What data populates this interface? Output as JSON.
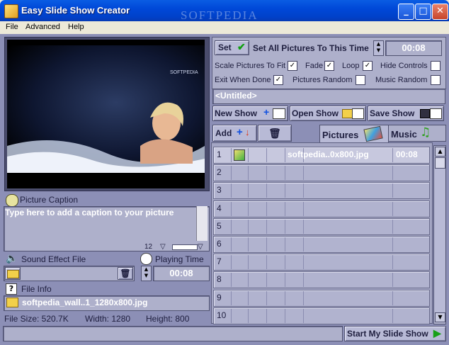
{
  "window": {
    "title": "Easy Slide Show Creator",
    "watermark": "SOFTPEDIA"
  },
  "menu": [
    "File",
    "Advanced",
    "Help"
  ],
  "preview": {
    "watermark": "SOFTPEDIA"
  },
  "caption": {
    "title": "Picture Caption",
    "text": "Type here to add a caption to your picture",
    "font_size": "12"
  },
  "sound": {
    "title": "Sound Effect File"
  },
  "playing_time": {
    "title": "Playing Time",
    "value": "00:08"
  },
  "file_info": {
    "title": "File Info",
    "filename": "softpedia_wall..1_1280x800.jpg",
    "file_size": "File Size: 520.7K",
    "width": "Width: 1280",
    "height": "Height: 800"
  },
  "settings": {
    "set_label": "Set",
    "set_all_label": "Set All Pictures To This Time",
    "time_value": "00:08",
    "scale_label": "Scale Pictures To Fit",
    "fade_label": "Fade",
    "loop_label": "Loop",
    "hide_controls_label": "Hide Controls",
    "exit_label": "Exit When Done",
    "pictures_random_label": "Pictures Random",
    "music_random_label": "Music Random",
    "scale_checked": true,
    "fade_checked": true,
    "loop_checked": true,
    "hide_checked": false,
    "exit_checked": true,
    "pic_random_checked": false,
    "music_random_checked": false
  },
  "show_name": "<Untitled>",
  "show_buttons": {
    "new": "New Show",
    "open": "Open Show",
    "save": "Save Show"
  },
  "tabs": {
    "add": "Add",
    "pictures": "Pictures",
    "music": "Music"
  },
  "list": [
    {
      "num": "1",
      "name": "softpedia..0x800.jpg",
      "time": "00:08"
    },
    {
      "num": "2",
      "name": "",
      "time": ""
    },
    {
      "num": "3",
      "name": "",
      "time": ""
    },
    {
      "num": "4",
      "name": "",
      "time": ""
    },
    {
      "num": "5",
      "name": "",
      "time": ""
    },
    {
      "num": "6",
      "name": "",
      "time": ""
    },
    {
      "num": "7",
      "name": "",
      "time": ""
    },
    {
      "num": "8",
      "name": "",
      "time": ""
    },
    {
      "num": "9",
      "name": "",
      "time": ""
    },
    {
      "num": "10",
      "name": "",
      "time": ""
    }
  ],
  "start_button": "Start My Slide Show",
  "icons": [
    "app-icon",
    "check-icon",
    "spin-up-icon",
    "spin-down-icon",
    "plus-icon",
    "trash-icon",
    "folder-icon",
    "save-disk-icon",
    "pictures-icon",
    "music-note-icon",
    "speaker-icon",
    "clock-icon",
    "help-icon",
    "caption-icon",
    "play-icon"
  ]
}
